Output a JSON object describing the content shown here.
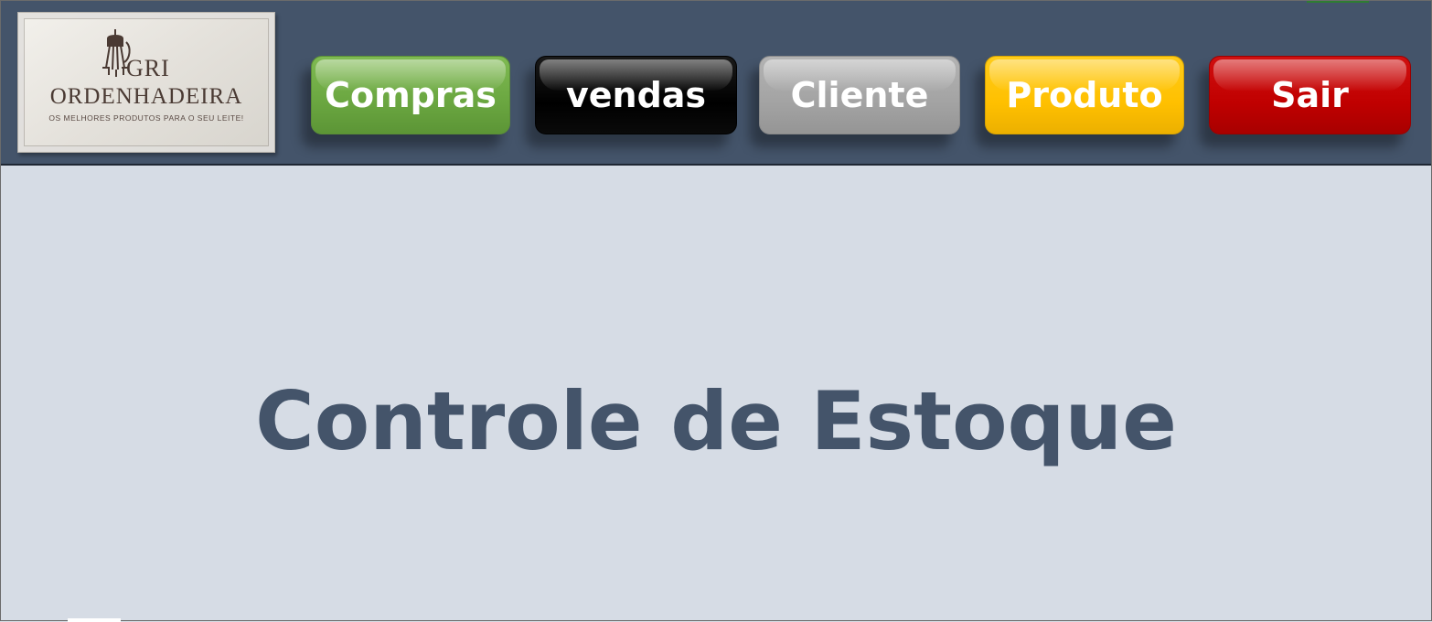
{
  "logo": {
    "line1": "GRI",
    "line2": "ORDENHADEIRA",
    "tagline": "OS MELHORES PRODUTOS PARA O SEU LEITE!"
  },
  "nav": {
    "compras": "Compras",
    "vendas": "vendas",
    "cliente": "Cliente",
    "produto": "Produto",
    "sair": "Sair"
  },
  "main": {
    "title": "Controle de Estoque"
  },
  "colors": {
    "header_bg": "#44546a",
    "page_bg": "#d6dce5",
    "compras": "#70ad47",
    "vendas": "#000000",
    "cliente": "#a5a5a5",
    "produto": "#ffc000",
    "sair": "#c00000"
  }
}
